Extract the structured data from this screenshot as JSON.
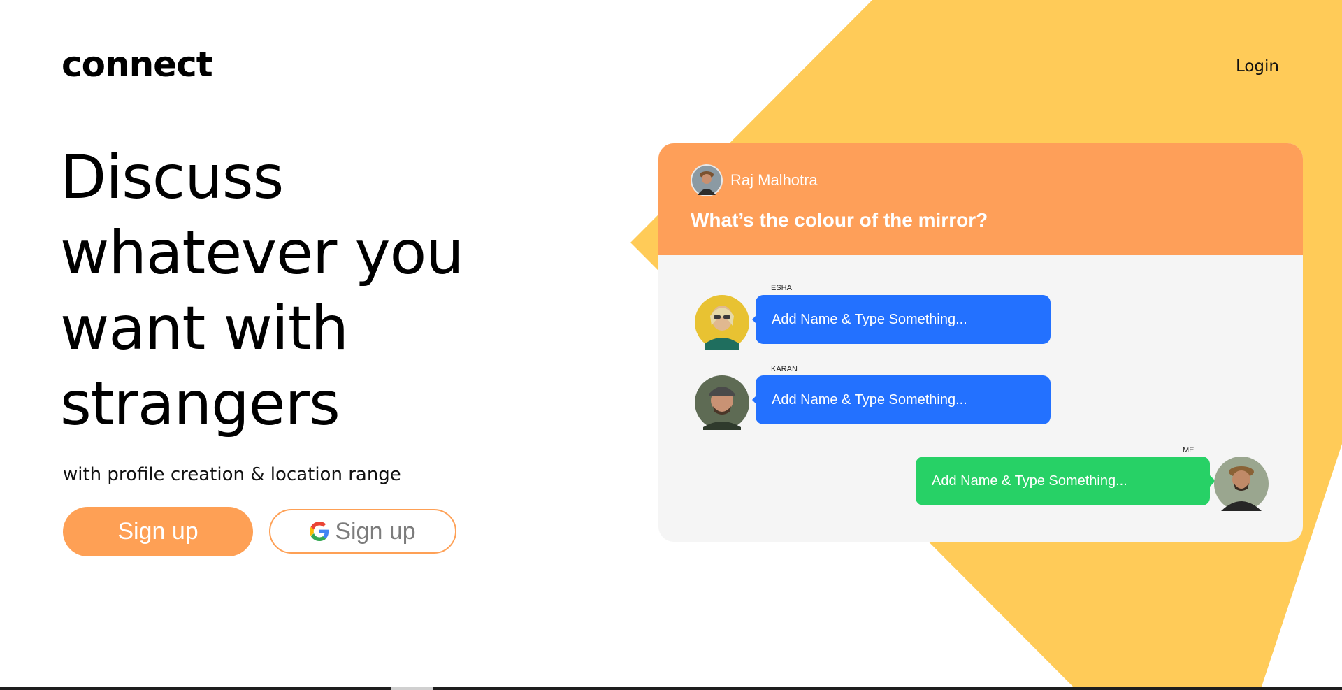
{
  "brand": {
    "logo_text": "connect"
  },
  "nav": {
    "login_label": "Login"
  },
  "hero": {
    "headline_lines": [
      "Discuss",
      "whatever you",
      "want with",
      "strangers"
    ],
    "subtitle": "with profile creation & location range",
    "signup_label": "Sign up",
    "google_signup_label": "Sign up"
  },
  "chat": {
    "host_name": "Raj Malhotra",
    "question": "What’s the colour of the mirror?",
    "messages": [
      {
        "author": "ESHA",
        "text": "Add Name & Type Something...",
        "color": "#2371ff"
      },
      {
        "author": "KARAN",
        "text": "Add Name & Type Something...",
        "color": "#2371ff"
      },
      {
        "author": "ME",
        "text": "Add Name & Type Something...",
        "color": "#27d166"
      }
    ]
  },
  "colors": {
    "accent_orange": "#fea055",
    "header_orange": "#fe9f59",
    "background_yellow": "#ffcb58",
    "bubble_blue": "#2371ff",
    "bubble_green": "#27d166",
    "chat_background": "#f5f5f5"
  },
  "icons": {
    "google": "google-g-icon"
  }
}
